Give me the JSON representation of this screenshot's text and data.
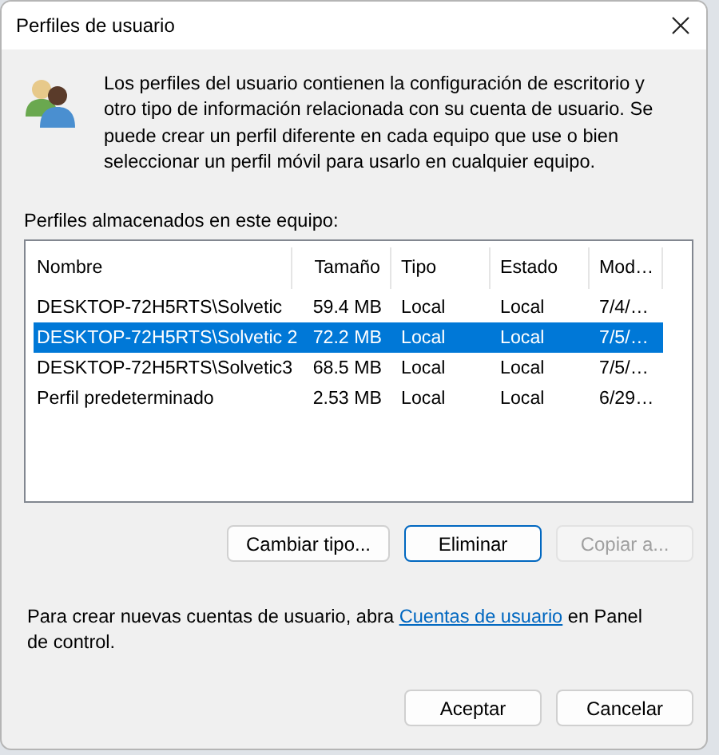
{
  "window": {
    "title": "Perfiles de usuario"
  },
  "intro": "Los perfiles del usuario contienen la configuración de escritorio y otro tipo de información relacionada con su cuenta de usuario. Se puede crear un perfil diferente en cada equipo que use o bien seleccionar un perfil móvil para usarlo en cualquier equipo.",
  "list_label": "Perfiles almacenados en este equipo:",
  "table": {
    "columns": [
      "Nombre",
      "Tamaño",
      "Tipo",
      "Estado",
      "Mod…"
    ],
    "rows": [
      {
        "cells": [
          "DESKTOP-72H5RTS\\Solvetic",
          "59.4 MB",
          "Local",
          "Local",
          "7/4/…"
        ],
        "selected": false
      },
      {
        "cells": [
          "DESKTOP-72H5RTS\\Solvetic 2",
          "72.2 MB",
          "Local",
          "Local",
          "7/5/…"
        ],
        "selected": true
      },
      {
        "cells": [
          "DESKTOP-72H5RTS\\Solvetic3",
          "68.5 MB",
          "Local",
          "Local",
          "7/5/…"
        ],
        "selected": false
      },
      {
        "cells": [
          "Perfil predeterminado",
          "2.53 MB",
          "Local",
          "Local",
          "6/29…"
        ],
        "selected": false
      }
    ]
  },
  "actions": [
    {
      "label": "Cambiar tipo...",
      "disabled": false,
      "default": false
    },
    {
      "label": "Eliminar",
      "disabled": false,
      "default": true
    },
    {
      "label": "Copiar a...",
      "disabled": true,
      "default": false
    }
  ],
  "footer": {
    "before": "Para crear nuevas cuentas de usuario, abra ",
    "link": "Cuentas de usuario",
    "after": " en Panel de control."
  },
  "dialog_buttons": [
    {
      "label": "Aceptar",
      "disabled": false,
      "default": false
    },
    {
      "label": "Cancelar",
      "disabled": false,
      "default": false
    }
  ]
}
